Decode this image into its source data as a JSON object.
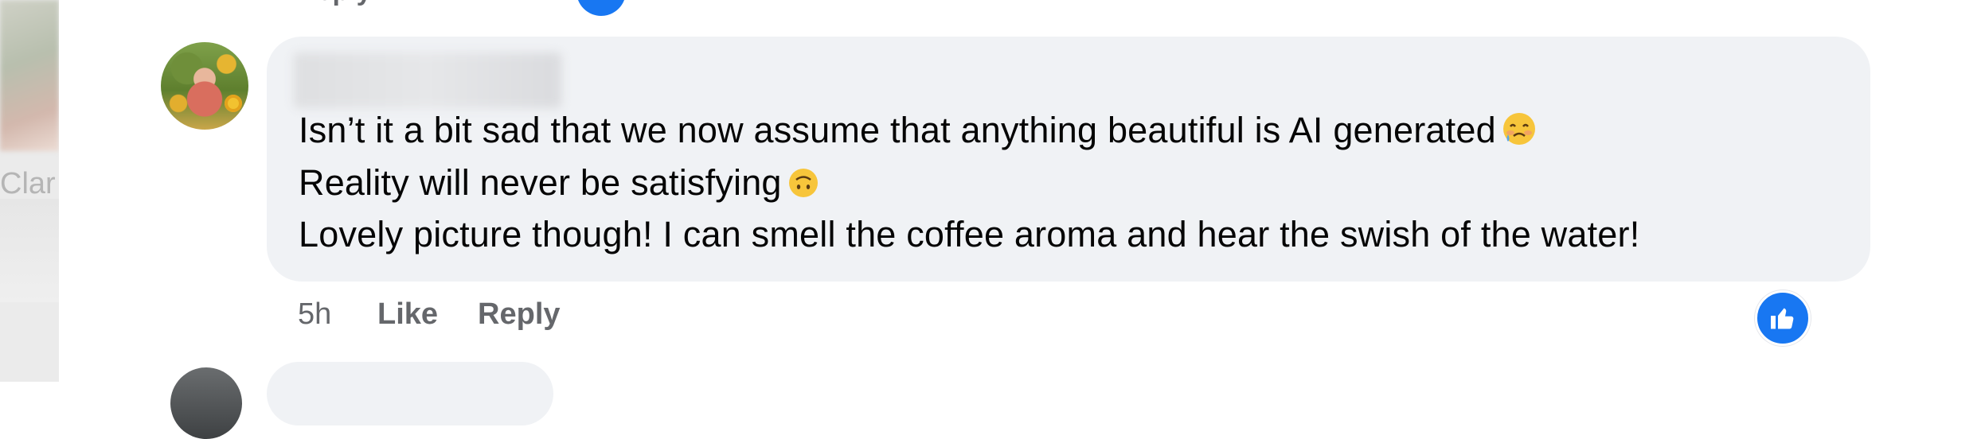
{
  "left_panel": {
    "partial_name": "Clar"
  },
  "top_comment_partial": {
    "reply_label": "Reply"
  },
  "comment": {
    "author": "",
    "lines": [
      "Isn’t it a bit sad that we now assume that anything beautiful is AI generated",
      "Reality will never be satisfying",
      "Lovely picture though! I can smell the coffee aroma and hear the swish of the water!"
    ],
    "line_emojis": [
      "face-holding-back-tears-emoji",
      "upside-down-face-emoji"
    ],
    "timestamp": "5h",
    "like_label": "Like",
    "reply_label": "Reply",
    "reaction_icon": "thumbs-up-icon",
    "colors": {
      "bubble": "#f0f2f5",
      "text": "#050505",
      "meta": "#65676b",
      "reaction": "#1877f2"
    }
  }
}
